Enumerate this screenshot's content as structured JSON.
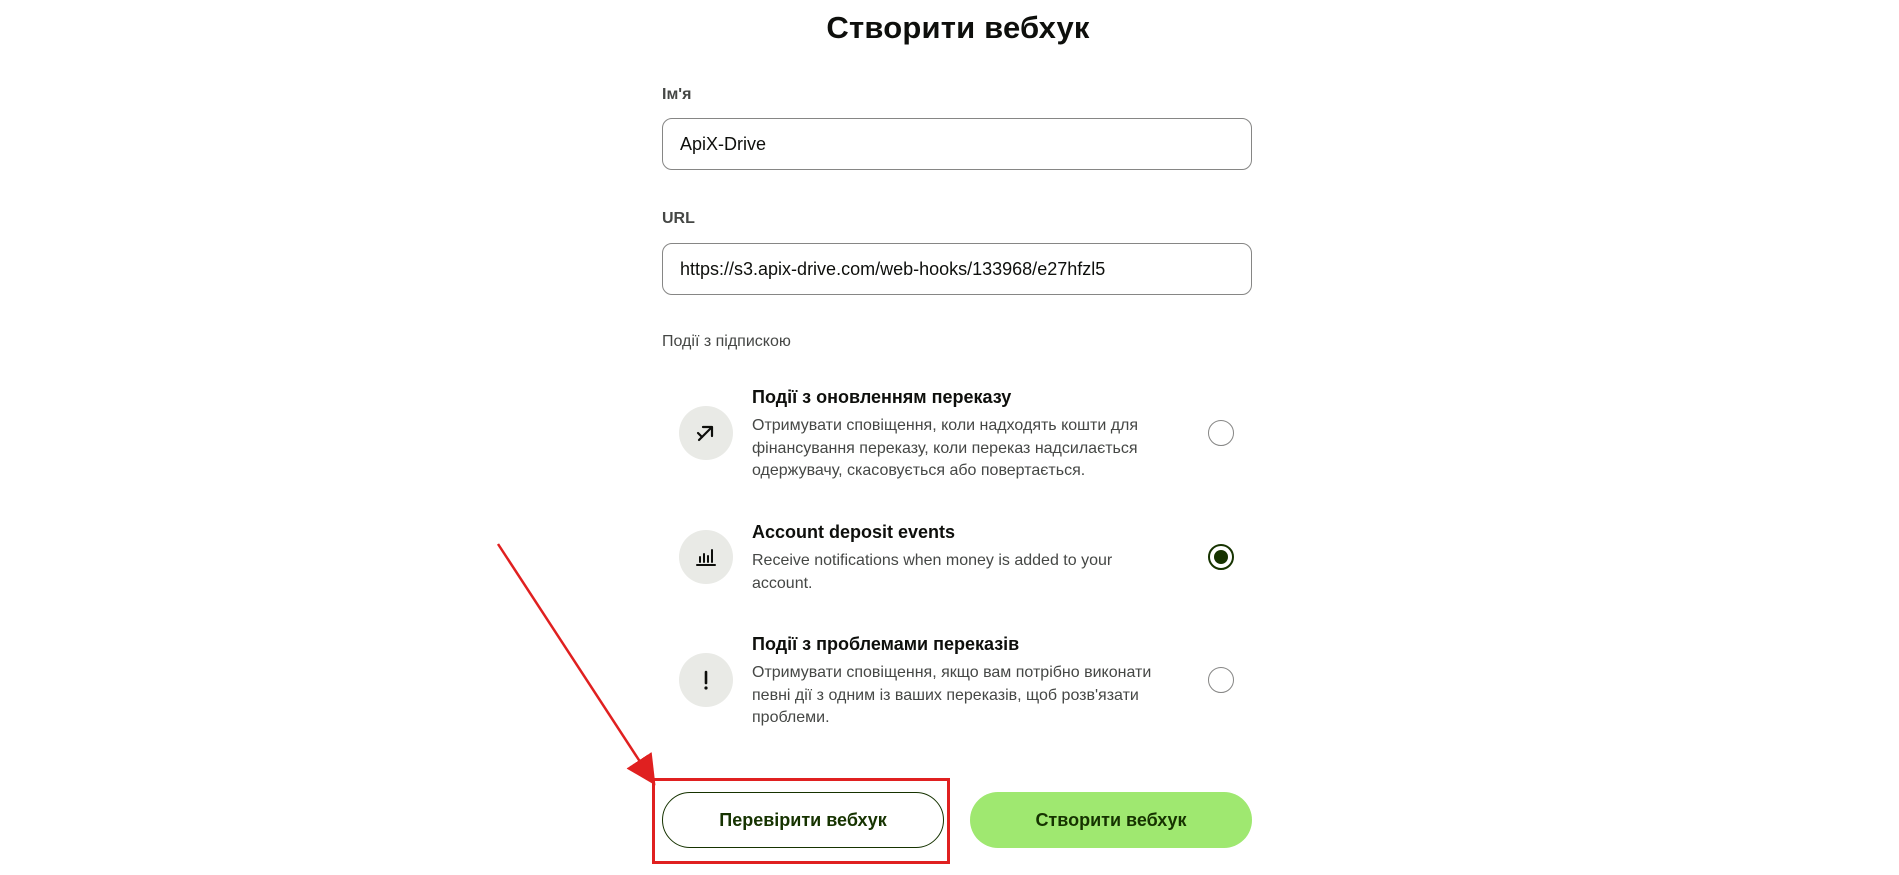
{
  "title": "Створити вебхук",
  "name_field": {
    "label": "Ім'я",
    "value": "ApiX-Drive"
  },
  "url_field": {
    "label": "URL",
    "value": "https://s3.apix-drive.com/web-hooks/133968/e27hfzl5"
  },
  "events": {
    "section_label": "Події з підпискою",
    "items": [
      {
        "title": "Події з оновленням переказу",
        "description": "Отримувати сповіщення, коли надходять кошти для фінансування переказу, коли переказ надсилається одержувачу, скасовується або повертається.",
        "icon": "arrow-up-right-icon",
        "selected": false
      },
      {
        "title": "Account deposit events",
        "description": "Receive notifications when money is added to your account.",
        "icon": "bar-chart-icon",
        "selected": true
      },
      {
        "title": "Події з проблемами переказів",
        "description": "Отримувати сповіщення, якщо вам потрібно виконати певні дії з одним із ваших переказів, щоб розв'язати проблеми.",
        "icon": "exclamation-icon",
        "selected": false
      }
    ]
  },
  "buttons": {
    "test_label": "Перевірити вебхук",
    "create_label": "Створити вебхук"
  },
  "colors": {
    "primary_button": "#9fe870",
    "accent_dark": "#163300",
    "annotation": "#e02020"
  }
}
